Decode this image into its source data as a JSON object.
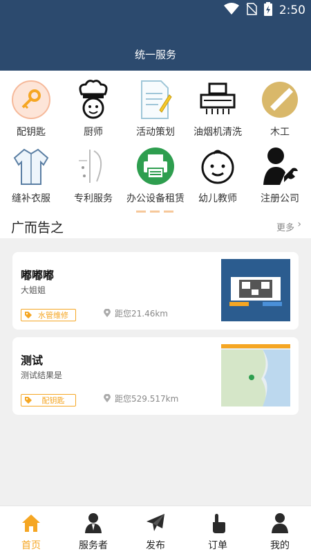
{
  "status": {
    "time": "2:50"
  },
  "header": {
    "title": "统一服务"
  },
  "services": [
    {
      "label": "配钥匙",
      "icon": "key-icon"
    },
    {
      "label": "厨师",
      "icon": "chef-icon"
    },
    {
      "label": "活动策划",
      "icon": "document-pen-icon"
    },
    {
      "label": "油烟机清洗",
      "icon": "range-hood-icon"
    },
    {
      "label": "木工",
      "icon": "saw-icon"
    },
    {
      "label": "缝补衣服",
      "icon": "shirt-icon"
    },
    {
      "label": "专利服务",
      "icon": "patent-icon"
    },
    {
      "label": "办公设备租赁",
      "icon": "printer-icon"
    },
    {
      "label": "幼儿教师",
      "icon": "baby-face-icon"
    },
    {
      "label": "注册公司",
      "icon": "person-wrench-icon"
    }
  ],
  "ads": {
    "title": "广而告之",
    "more": "更多"
  },
  "cards": [
    {
      "name": "嘟嘟嘟",
      "sub": "大姐姐",
      "tag": "水管维修",
      "distance": "距您21.46km"
    },
    {
      "name": "测试",
      "sub": "测试结果是",
      "tag": "配钥匙",
      "distance": "距您529.517km"
    }
  ],
  "tabs": [
    {
      "label": "首页",
      "icon": "home-icon",
      "active": true
    },
    {
      "label": "服务者",
      "icon": "service-person-icon"
    },
    {
      "label": "发布",
      "icon": "send-icon"
    },
    {
      "label": "订单",
      "icon": "tap-icon"
    },
    {
      "label": "我的",
      "icon": "user-icon"
    }
  ],
  "colors": {
    "header": "#2c4a6e",
    "accent": "#f5a623",
    "green": "#2e9e4f"
  }
}
